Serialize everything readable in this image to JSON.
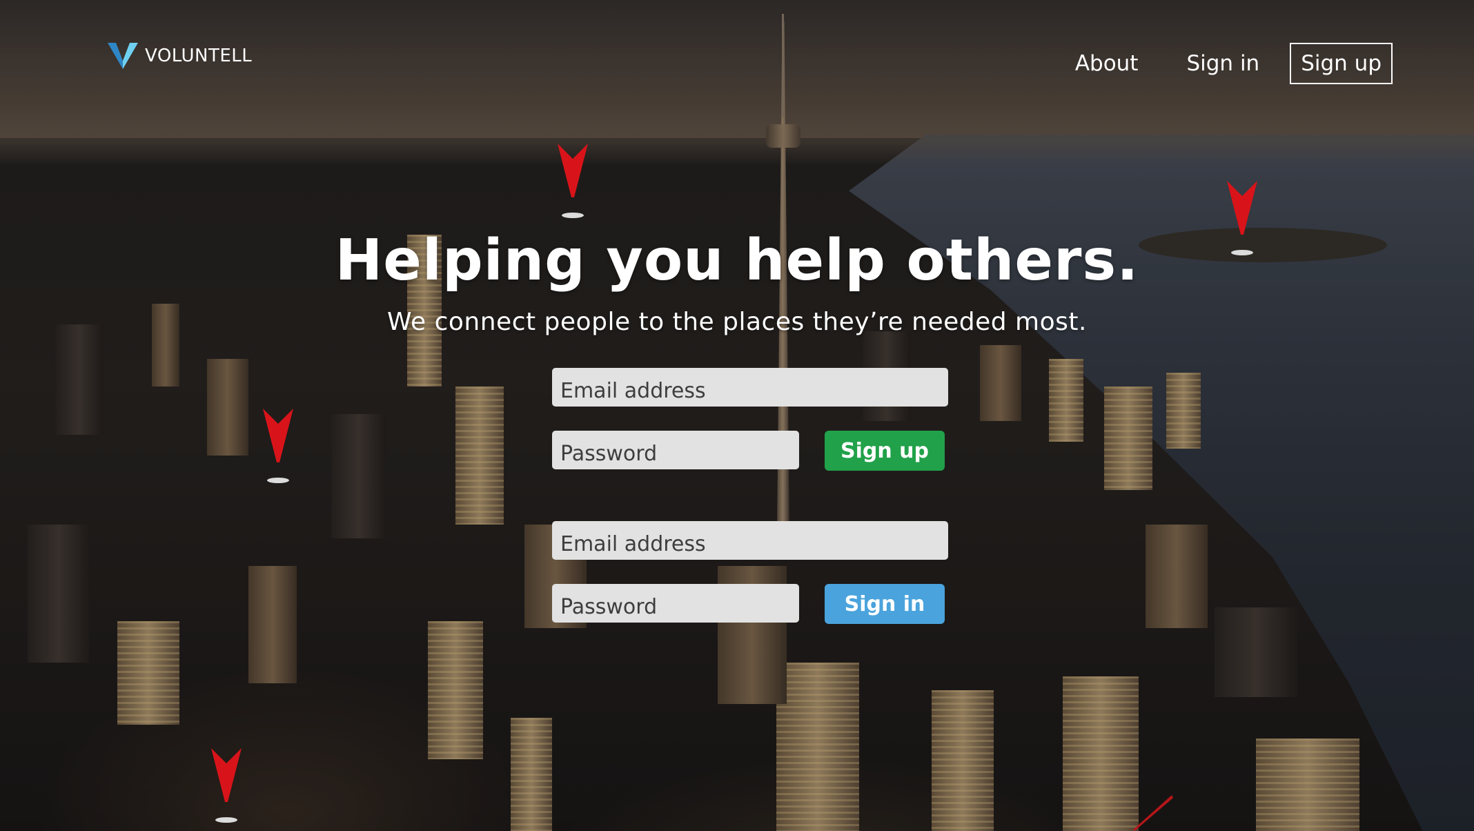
{
  "brand": {
    "name": "VOLUNTELL",
    "logo_icon": "v-logo-icon",
    "logo_colors": [
      "#2f86c6",
      "#6fd0f0"
    ]
  },
  "nav": {
    "about": "About",
    "sign_in": "Sign in",
    "sign_up": "Sign up"
  },
  "hero": {
    "title": "Helping you help others.",
    "subtitle": "We connect people to the places they’re needed most."
  },
  "signup_form": {
    "email_placeholder": "Email address",
    "password_placeholder": "Password",
    "submit_label": "Sign up",
    "button_color": "#21a14a"
  },
  "signin_form": {
    "email_placeholder": "Email address",
    "password_placeholder": "Password",
    "submit_label": "Sign in",
    "button_color": "#4aa3dc"
  },
  "map_pins": {
    "icon": "map-pin-icon",
    "color": "#d8141a",
    "count": 5
  }
}
